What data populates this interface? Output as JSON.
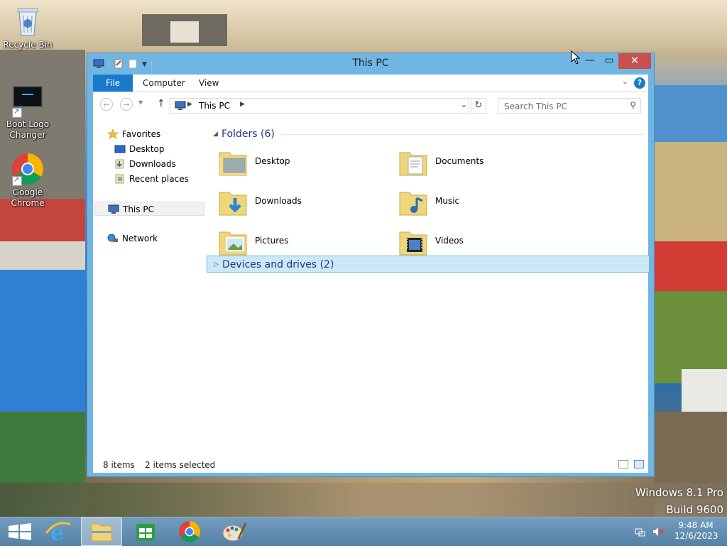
{
  "desktop": {
    "icons": [
      {
        "label": "Recycle Bin"
      },
      {
        "label": "Boot Logo Changer"
      },
      {
        "label": "Google Chrome"
      }
    ],
    "watermark": {
      "line1": "Windows 8.1 Pro",
      "line2": "Build 9600"
    }
  },
  "window": {
    "title": "This PC",
    "ribbon_tabs": [
      {
        "label": "File"
      },
      {
        "label": "Computer"
      },
      {
        "label": "View"
      }
    ],
    "help_label": "?",
    "address": {
      "crumb": "This PC"
    },
    "search": {
      "placeholder": "Search This PC",
      "value": ""
    },
    "nav_pane": {
      "favorites": "Favorites",
      "favorites_items": [
        {
          "label": "Desktop"
        },
        {
          "label": "Downloads"
        },
        {
          "label": "Recent places"
        }
      ],
      "this_pc": "This PC",
      "network": "Network"
    },
    "content": {
      "folders_header": "Folders (6)",
      "folders": [
        {
          "label": "Desktop",
          "icon": "desktop-folder-icon"
        },
        {
          "label": "Documents",
          "icon": "documents-folder-icon"
        },
        {
          "label": "Downloads",
          "icon": "downloads-folder-icon"
        },
        {
          "label": "Music",
          "icon": "music-folder-icon"
        },
        {
          "label": "Pictures",
          "icon": "pictures-folder-icon"
        },
        {
          "label": "Videos",
          "icon": "videos-folder-icon"
        }
      ],
      "devices_header": "Devices and drives (2)"
    },
    "status": {
      "items": "8 items",
      "selected": "2 items selected"
    }
  },
  "taskbar": {
    "clock_time": "9:48 AM",
    "clock_date": "12/6/2023"
  },
  "colors": {
    "accent": "#1979ca",
    "window_frame": "#6fb6e3",
    "close": "#c7504b",
    "group_header": "#1e3287"
  }
}
